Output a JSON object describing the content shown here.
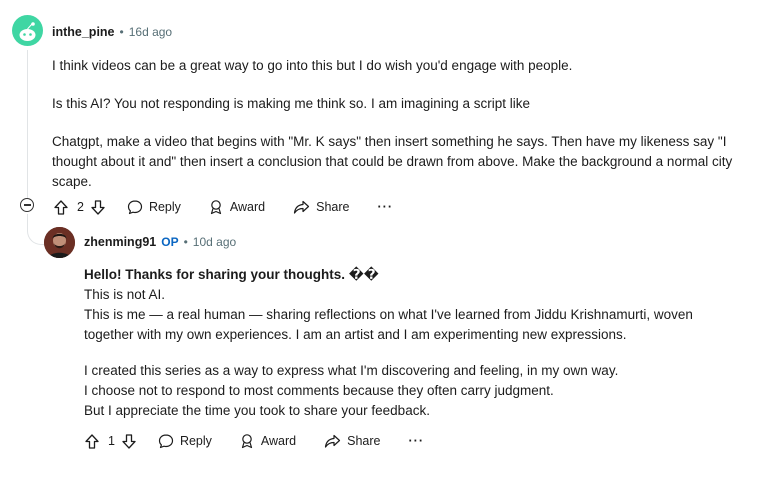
{
  "comment1": {
    "username": "inthe_pine",
    "dot": "•",
    "time": "16d ago",
    "paragraphs": [
      "I think videos can be a great way to go into this but I do wish you'd engage with people.",
      "Is this AI? You not responding is making me think so. I am imagining a script like",
      "Chatgpt, make a video that begins with \"Mr. K says\" then insert something he says. Then have my likeness say \"I thought about it and\" then insert a conclusion that could be drawn from above. Make the background a normal city scape."
    ],
    "votes": "2",
    "reply": "Reply",
    "award": "Award",
    "share": "Share",
    "more": "···"
  },
  "comment2": {
    "username": "zhenming91",
    "op": "OP",
    "dot": "•",
    "time": "10d ago",
    "bold_line": "Hello! Thanks for sharing your thoughts. ��",
    "line2": "This is not AI.",
    "line3": "This is me — a real human — sharing reflections on what I've learned from Jiddu Krishnamurti, woven together with my own experiences. I am an artist and I am experimenting new expressions.",
    "line4": "I created this series as a way to express what I'm discovering and feeling, in my own way.",
    "line5": "I choose not to respond to most comments because they often carry judgment.",
    "line6": "But I appreciate the time you took to share your feedback.",
    "votes": "1",
    "reply": "Reply",
    "award": "Award",
    "share": "Share",
    "more": "···"
  }
}
